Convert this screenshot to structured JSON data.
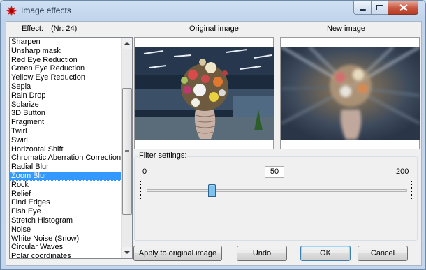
{
  "window": {
    "title": "Image effects"
  },
  "effect_header": {
    "label": "Effect:",
    "count": "(Nr: 24)"
  },
  "effects": {
    "items": [
      "Sharpen",
      "Unsharp mask",
      "Red Eye Reduction",
      "Green Eye Reduction",
      "Yellow Eye Reduction",
      "Sepia",
      "Rain Drop",
      "Solarize",
      "3D Button",
      "Fragment",
      "Twirl",
      "Swirl",
      "Horizontal Shift",
      "Chromatic Aberration Correction",
      "Radial Blur",
      "Zoom Blur",
      "Rock",
      "Relief",
      "Find Edges",
      "Fish Eye",
      "Stretch Histogram",
      "Noise",
      "White Noise (Snow)",
      "Circular Waves",
      "Polar coordinates"
    ],
    "selected": "Zoom Blur"
  },
  "original": {
    "label": "Original image"
  },
  "preview": {
    "label": "New image"
  },
  "filter": {
    "label": "Filter settings:",
    "min": "0",
    "value": "50",
    "max": "200",
    "slider_fraction": 0.25
  },
  "buttons": {
    "apply": "Apply to original image",
    "undo": "Undo",
    "ok": "OK",
    "cancel": "Cancel"
  },
  "colors": {
    "selection": "#3399ff",
    "close_button": "#c95a44"
  }
}
